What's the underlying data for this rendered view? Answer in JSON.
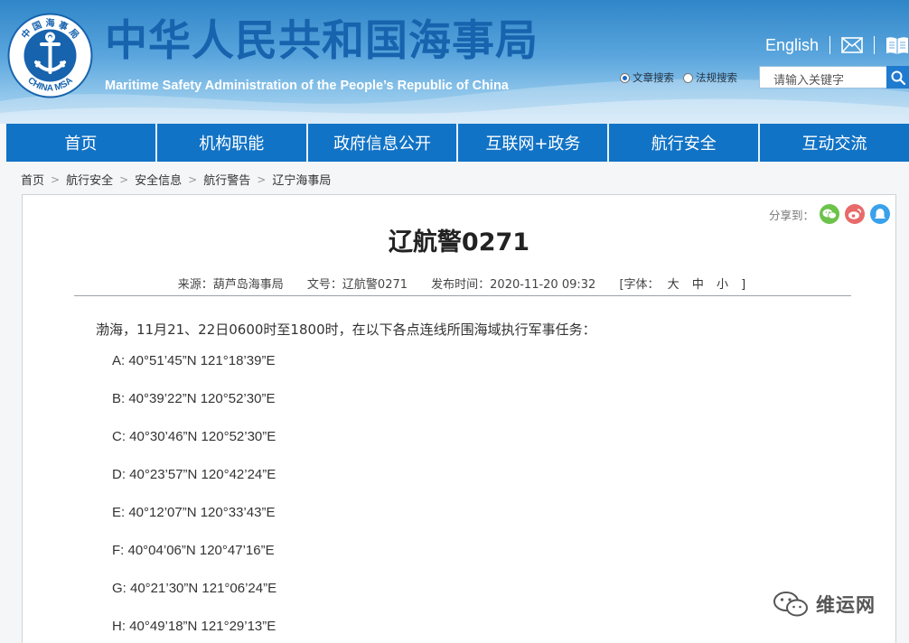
{
  "header": {
    "logo_text": "中国海事局 CHINA MSA",
    "site_title": "中华人民共和国海事局",
    "site_subtitle": "Maritime Safety Administration of the People’s Republic of China",
    "english_link": "English",
    "search_types": [
      "文章搜索",
      "法规搜索"
    ],
    "search_placeholder": "请输入关键字"
  },
  "nav": [
    "首页",
    "机构职能",
    "政府信息公开",
    "互联网+政务",
    "航行安全",
    "互动交流"
  ],
  "breadcrumb": [
    "首页",
    "航行安全",
    "安全信息",
    "航行警告",
    "辽宁海事局"
  ],
  "article": {
    "share_label": "分享到：",
    "title": "辽航警0271",
    "source": "来源：葫芦岛海事局",
    "doc_no": "文号：辽航警0271",
    "published": "发布时间：2020-11-20 09:32",
    "font_size_label": "[字体：",
    "font_sizes": [
      "大",
      "中",
      "小"
    ],
    "font_size_close": "]",
    "intro": "渤海，11月21、22日0600时至1800时，在以下各点连线所围海域执行军事任务：",
    "coordinates": [
      "A: 40°51’45”N 121°18’39”E",
      "B: 40°39’22”N 120°52’30”E",
      "C: 40°30’46”N 120°52’30”E",
      "D: 40°23’57”N 120°42’24”E",
      "E: 40°12’07”N 120°33’43”E",
      "F: 40°04’06”N 120°47’16”E",
      "G: 40°21’30”N 121°06’24”E",
      "H: 40°49’18”N 121°29’13”E"
    ]
  },
  "watermark": "维运网",
  "colors": {
    "nav": "#1173c6",
    "title": "#1763ad",
    "wechat": "#6cc24a",
    "weibo": "#e86a6a",
    "qzone": "#3aa1ea"
  }
}
